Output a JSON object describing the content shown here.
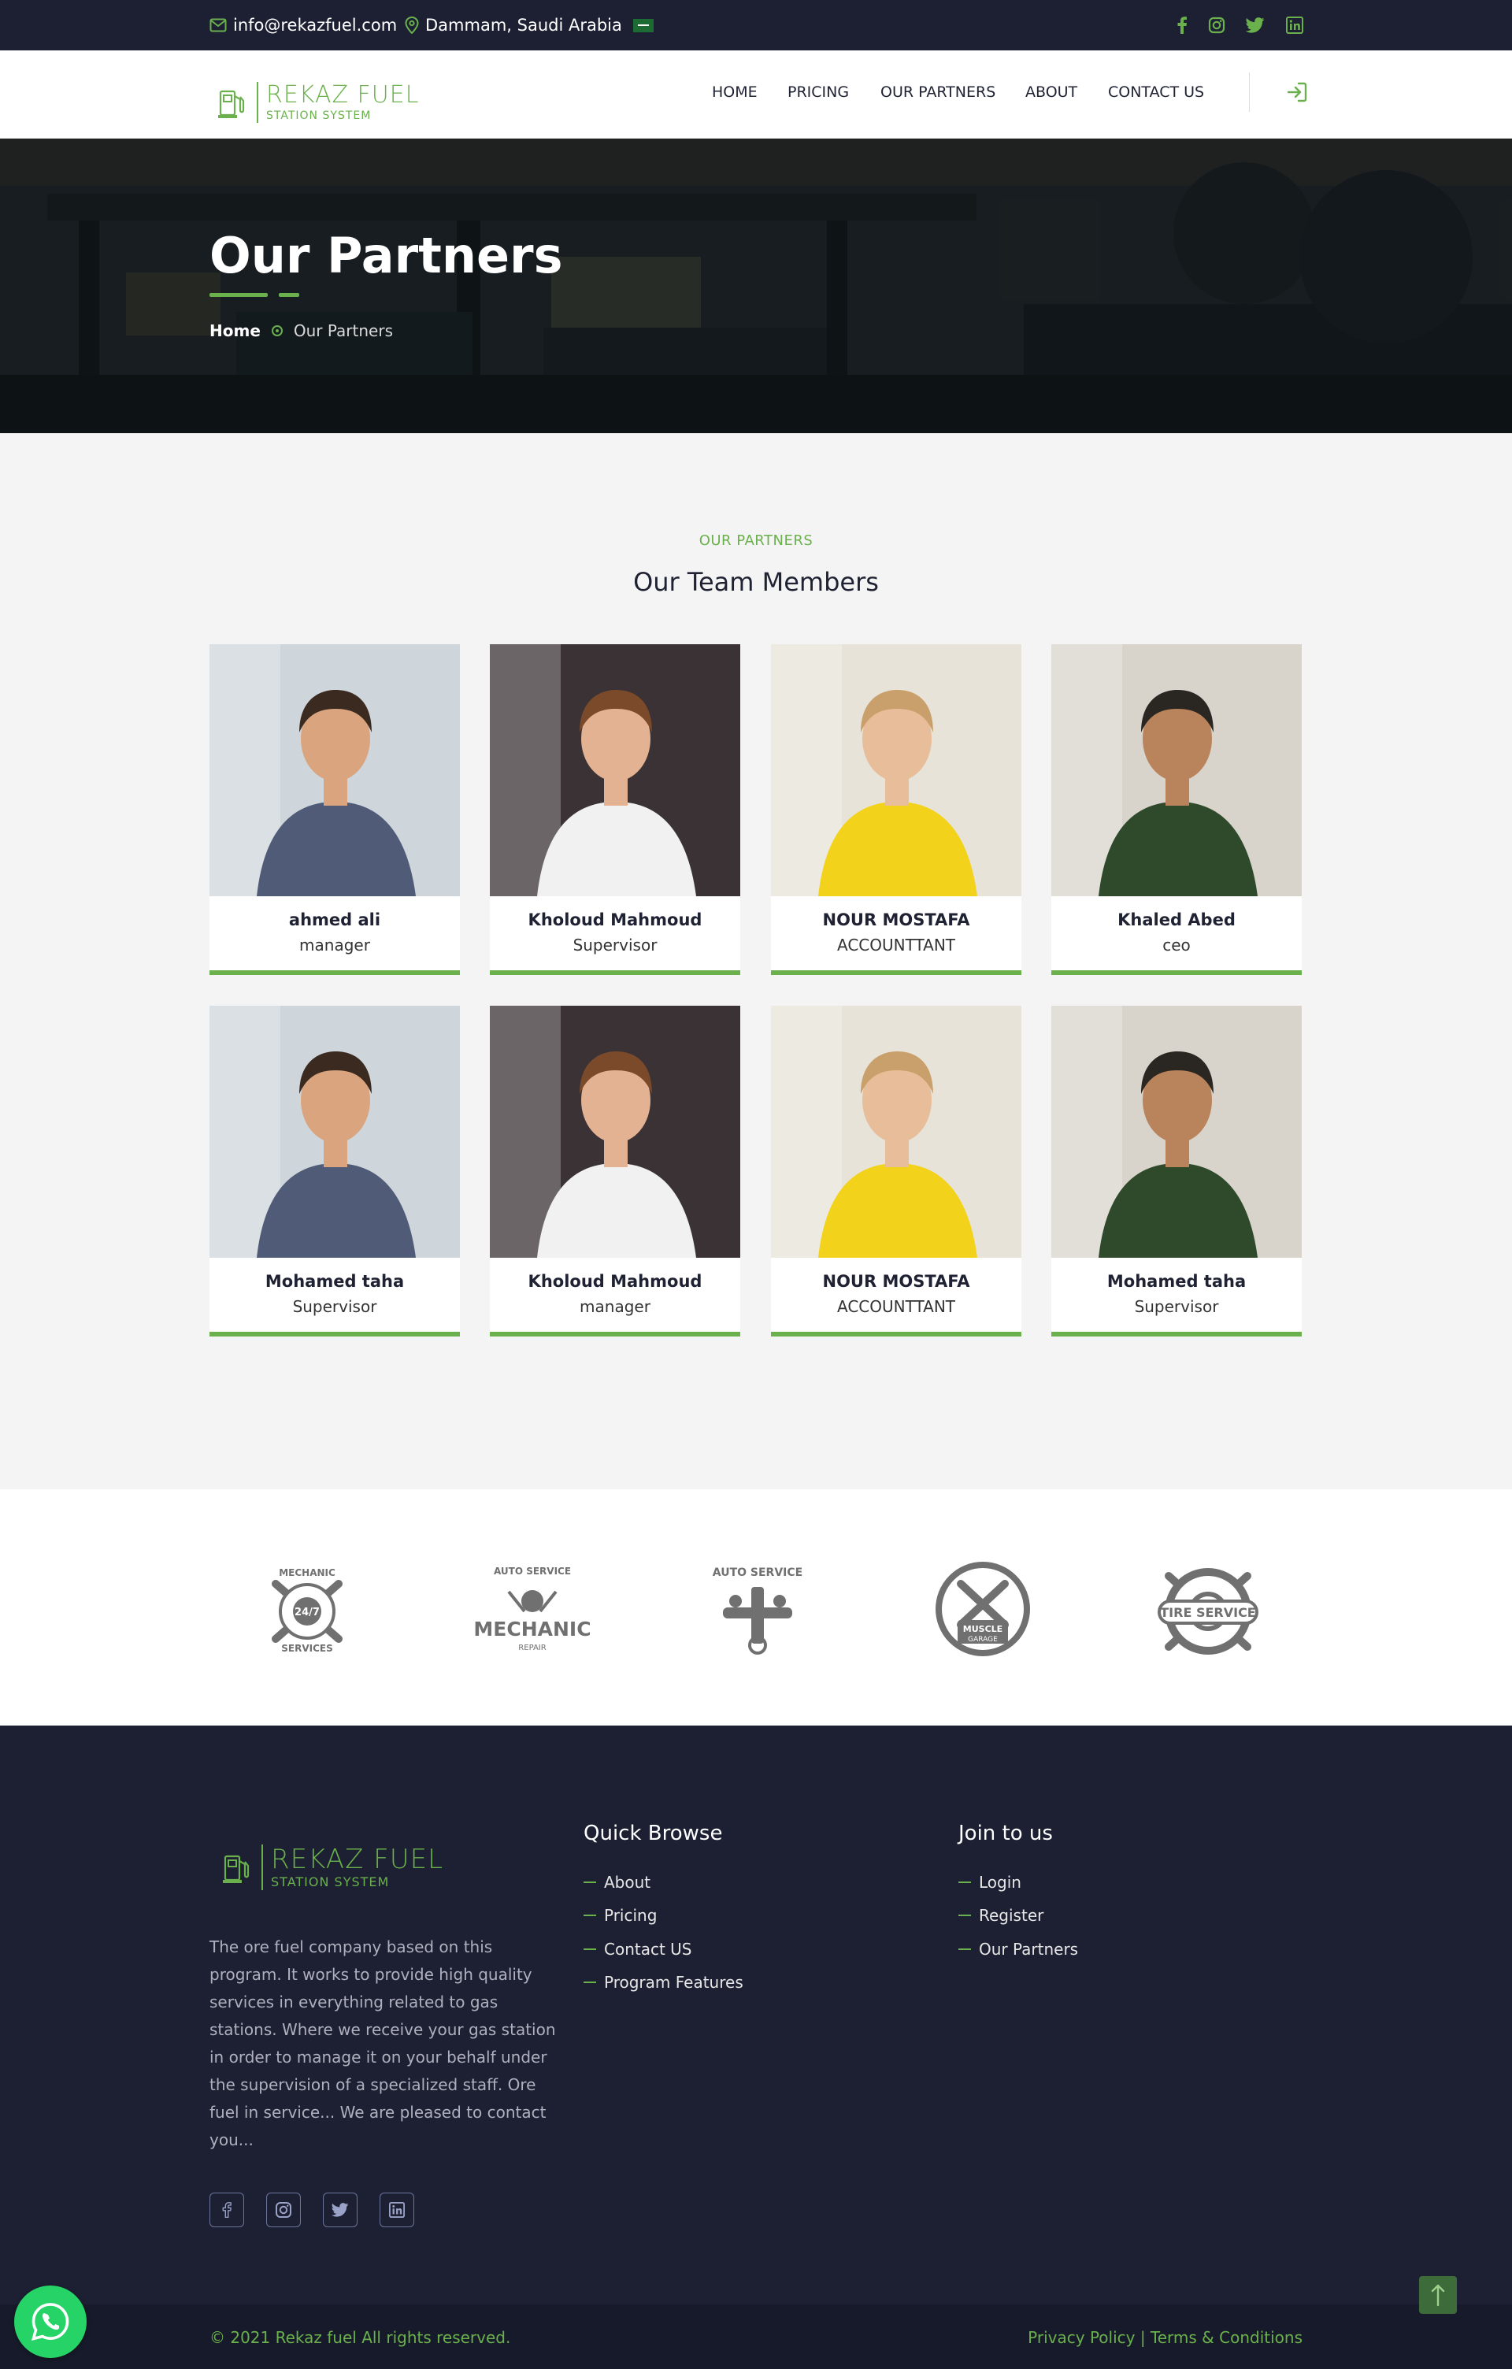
{
  "topbar": {
    "email": "info@rekazfuel.com",
    "location": "Dammam, Saudi Arabia",
    "social_icons": [
      "facebook-icon",
      "instagram-icon",
      "twitter-icon",
      "linkedin-icon"
    ]
  },
  "header": {
    "logo_name": "REKAZ FUEL",
    "logo_subtitle": "STATION SYSTEM",
    "nav": [
      "HOME",
      "PRICING",
      "OUR PARTNERS",
      "ABOUT",
      "CONTACT US"
    ]
  },
  "hero": {
    "title": "Our Partners",
    "breadcrumb_home": "Home",
    "breadcrumb_current": "Our Partners"
  },
  "team": {
    "label": "OUR PARTNERS",
    "title": "Our Team Members",
    "members": [
      {
        "name": "ahmed ali",
        "role": "manager"
      },
      {
        "name": "Kholoud Mahmoud",
        "role": "Supervisor"
      },
      {
        "name": "NOUR MOSTAFA",
        "role": "ACCOUNTTANT"
      },
      {
        "name": "Khaled Abed",
        "role": "ceo"
      },
      {
        "name": "Mohamed taha",
        "role": "Supervisor"
      },
      {
        "name": "Kholoud Mahmoud",
        "role": "manager"
      },
      {
        "name": "NOUR MOSTAFA",
        "role": "ACCOUNTTANT"
      },
      {
        "name": "Mohamed taha",
        "role": "Supervisor"
      }
    ]
  },
  "brands": [
    {
      "top": "MECHANIC",
      "center": "24/7",
      "bottom": "SERVICES"
    },
    {
      "top": "AUTO SERVICE",
      "center": "MECHANIC",
      "bottom": "REPAIR"
    },
    {
      "top": "AUTO SERVICE",
      "center": "",
      "bottom": ""
    },
    {
      "top": "",
      "center": "MUSCLE",
      "bottom": "GARAGE"
    },
    {
      "top": "",
      "center": "TIRE SERVICE",
      "bottom": ""
    }
  ],
  "footer": {
    "logo_name": "REKAZ FUEL",
    "logo_subtitle": "STATION SYSTEM",
    "about": "The ore fuel company based on this program. It works to provide high quality services in everything related to gas stations. Where we receive your gas station in order to manage it on your behalf under the supervision of a specialized staff. Ore fuel in service... We are pleased to contact you...",
    "quick_browse_title": "Quick Browse",
    "quick_browse": [
      "About",
      "Pricing",
      "Contact US",
      "Program Features"
    ],
    "join_title": "Join to us",
    "join": [
      "Login",
      "Register",
      "Our Partners"
    ],
    "copyright": "© 2021 Rekaz fuel All rights reserved.",
    "policy": "Privacy Policy | Terms & Conditions"
  },
  "colors": {
    "accent": "#6ab04c",
    "dark": "#1d2033"
  }
}
